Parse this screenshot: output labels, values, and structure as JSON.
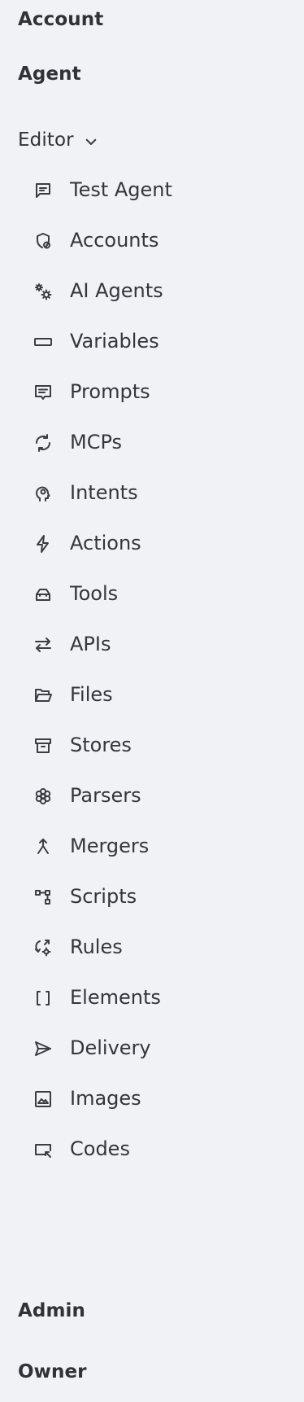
{
  "sections": {
    "account": "Account",
    "agent": "Agent",
    "editor": "Editor",
    "admin": "Admin",
    "owner": "Owner"
  },
  "editor_items": [
    {
      "label": "Test Agent",
      "icon": "message-square-icon"
    },
    {
      "label": "Accounts",
      "icon": "shield-account-icon"
    },
    {
      "label": "AI Agents",
      "icon": "gears-icon"
    },
    {
      "label": "Variables",
      "icon": "rectangle-icon"
    },
    {
      "label": "Prompts",
      "icon": "prompt-bubble-icon"
    },
    {
      "label": "MCPs",
      "icon": "refresh-cycle-icon"
    },
    {
      "label": "Intents",
      "icon": "brain-head-icon"
    },
    {
      "label": "Actions",
      "icon": "lightning-icon"
    },
    {
      "label": "Tools",
      "icon": "toolbox-icon"
    },
    {
      "label": "APIs",
      "icon": "arrows-swap-icon"
    },
    {
      "label": "Files",
      "icon": "folder-open-icon"
    },
    {
      "label": "Stores",
      "icon": "archive-icon"
    },
    {
      "label": "Parsers",
      "icon": "flower-icon"
    },
    {
      "label": "Mergers",
      "icon": "merge-icon"
    },
    {
      "label": "Scripts",
      "icon": "flowchart-icon"
    },
    {
      "label": "Rules",
      "icon": "rules-cycle-icon"
    },
    {
      "label": "Elements",
      "icon": "brackets-icon"
    },
    {
      "label": "Delivery",
      "icon": "send-icon"
    },
    {
      "label": "Images",
      "icon": "image-icon"
    },
    {
      "label": "Codes",
      "icon": "code-window-icon"
    }
  ]
}
